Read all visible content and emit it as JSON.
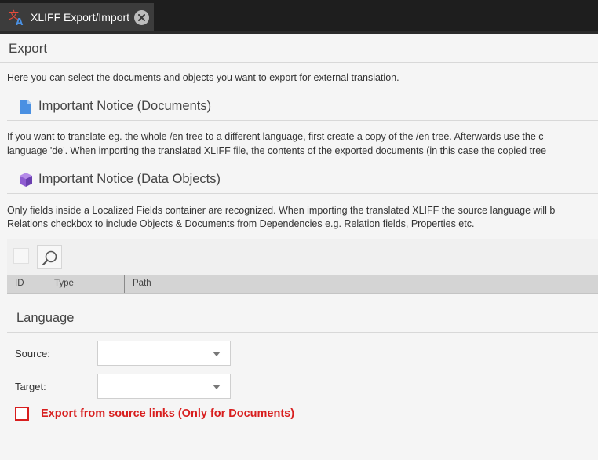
{
  "tab": {
    "title": "XLIFF Export/Import",
    "icon": "translate-icon"
  },
  "export_panel": {
    "title": "Export",
    "intro": "Here you can select the documents and objects you want to export for external translation."
  },
  "notice_documents": {
    "title": "Important Notice (Documents)",
    "line1": "If you want to translate eg. the whole /en tree to a different language, first create a copy of the /en tree. Afterwards use the c",
    "line2": "language 'de'. When importing the translated XLIFF file, the contents of the exported documents (in this case the copied tree"
  },
  "notice_objects": {
    "title": "Important Notice (Data Objects)",
    "line1": "Only fields inside a Localized Fields container are recognized. When importing the translated XLIFF the source language will b",
    "line2": "Relations checkbox to include Objects & Documents from Dependencies e.g. Relation fields, Properties etc."
  },
  "grid": {
    "columns": [
      "ID",
      "Type",
      "Path"
    ]
  },
  "language": {
    "title": "Language",
    "source_label": "Source:",
    "target_label": "Target:",
    "source_value": "",
    "target_value": ""
  },
  "export_links": {
    "label": "Export from source links (Only for Documents)",
    "checked": false
  },
  "colors": {
    "tab_bar": "#1e1e1e",
    "tab_active": "#3c3c3c",
    "accent_red": "#d81e1e",
    "doc_icon": "#4a90e2",
    "object_icon": "#8e5bd1"
  }
}
